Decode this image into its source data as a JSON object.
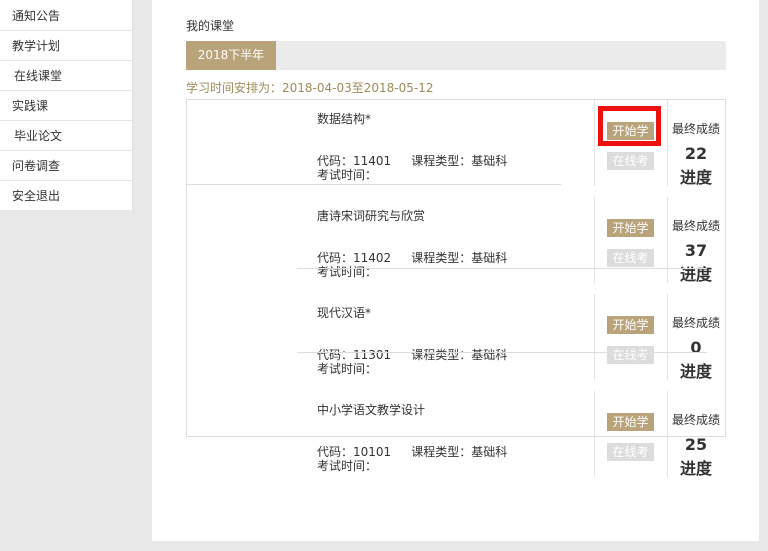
{
  "sidebar": {
    "items": [
      {
        "label": "通知公告"
      },
      {
        "label": "教学计划"
      },
      {
        "label": "在线课堂"
      },
      {
        "label": "实践课"
      },
      {
        "label": "毕业论文"
      },
      {
        "label": "问卷调查"
      },
      {
        "label": "安全退出"
      }
    ]
  },
  "main": {
    "title": "我的课堂",
    "term_tab": "2018下半年",
    "schedule": "学习时间安排为：2018-04-03至2018-05-12"
  },
  "labels": {
    "code": "代码：",
    "course_type": "课程类型：",
    "exam_time": "考试时间：",
    "start_button": "开始学",
    "exam_button": "在线考",
    "final_grade": "最终成绩",
    "progress": "进度"
  },
  "courses": [
    {
      "name": "数据结构*",
      "code": "11401",
      "type": "基础科",
      "exam_time": "",
      "grade": "22"
    },
    {
      "name": "唐诗宋词研究与欣赏",
      "code": "11402",
      "type": "基础科",
      "exam_time": "",
      "grade": "37"
    },
    {
      "name": "现代汉语*",
      "code": "11301",
      "type": "基础科",
      "exam_time": "",
      "grade": "0"
    },
    {
      "name": "中小学语文教学设计",
      "code": "10101",
      "type": "基础科",
      "exam_time": "",
      "grade": "25"
    }
  ],
  "colors": {
    "accent": "#b9a37a",
    "disabled": "#dcdcdc",
    "highlight": "#ee1111",
    "schedule_text": "#a08a5a"
  }
}
